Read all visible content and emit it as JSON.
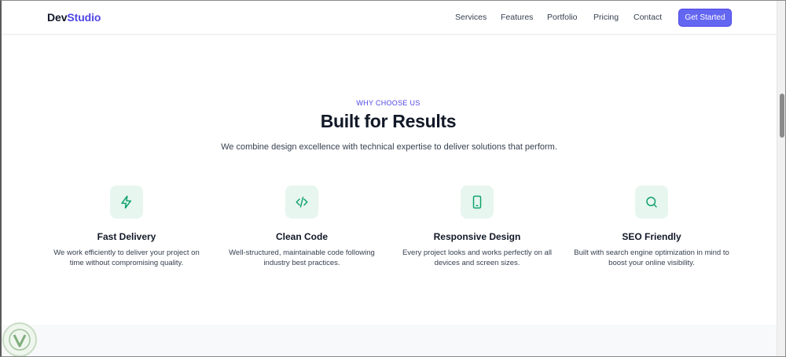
{
  "nav": {
    "logo_part1": "Dev",
    "logo_part2": "Studio",
    "links": [
      "Services",
      "Features",
      "Portfolio",
      "Pricing",
      "Contact"
    ],
    "cta": "Get Started"
  },
  "section": {
    "eyebrow": "WHY CHOOSE US",
    "title": "Built for Results",
    "subtitle": "We combine design excellence with technical expertise to deliver solutions that perform."
  },
  "features": [
    {
      "icon": "lightning-icon",
      "title": "Fast Delivery",
      "desc": "We work efficiently to deliver your project on time without compromising quality."
    },
    {
      "icon": "code-icon",
      "title": "Clean Code",
      "desc": "Well-structured, maintainable code following industry best practices."
    },
    {
      "icon": "smartphone-icon",
      "title": "Responsive Design",
      "desc": "Every project looks and works perfectly on all devices and screen sizes."
    },
    {
      "icon": "search-icon",
      "title": "SEO Friendly",
      "desc": "Built with search engine optimization in mind to boost your online visibility."
    }
  ],
  "colors": {
    "brand": "#4f46e5",
    "cta_bg": "#6366f1",
    "icon_bg": "#e7f6ef",
    "icon_stroke": "#10a36b"
  }
}
